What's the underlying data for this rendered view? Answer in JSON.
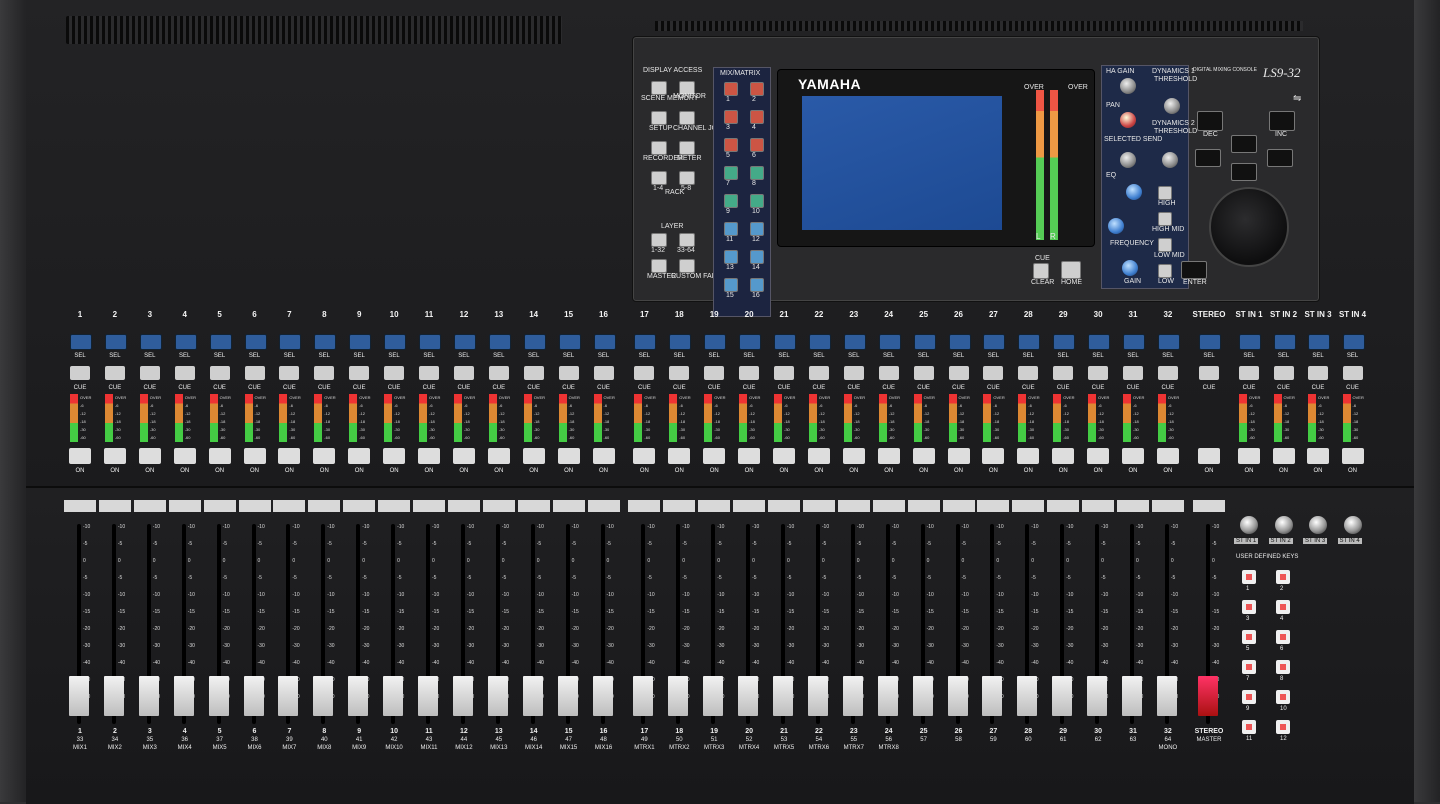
{
  "panel": {
    "display_access": "DISPLAY ACCESS",
    "scene_memory": "SCENE MEMORY",
    "monitor": "MONITOR",
    "setup": "SETUP",
    "channel_job": "CHANNEL JOB",
    "recorder": "RECORDER",
    "meter": "METER",
    "rack_1_4": "1-4",
    "rack": "RACK",
    "rack_5_8": "5-8",
    "layer": "LAYER",
    "layer_1_32": "1-32",
    "layer_33_64": "33-64",
    "master": "MASTER",
    "custom_fader": "CUSTOM FADER",
    "mix_matrix": "MIX/MATRIX",
    "mm_nums": [
      "1",
      "2",
      "3",
      "4",
      "5",
      "6",
      "7",
      "8",
      "9",
      "10",
      "11",
      "12",
      "13",
      "14",
      "15",
      "16"
    ],
    "brand": "YAMAHA",
    "over_l": "OVER",
    "over_r": "OVER",
    "l": "L",
    "r": "R",
    "cue": "CUE",
    "clear": "CLEAR",
    "home": "HOME",
    "ha_gain": "HA GAIN",
    "pan": "PAN",
    "selected_send": "SELECTED SEND",
    "eq": "EQ",
    "frequency": "FREQUENCY",
    "gain": "GAIN",
    "dynamics1": "DYNAMICS 1",
    "threshold1": "THRESHOLD",
    "dynamics2": "DYNAMICS 2",
    "threshold2": "THRESHOLD",
    "high": "HIGH",
    "high_mid": "HIGH MID",
    "low_mid": "LOW MID",
    "low": "LOW",
    "model_text": "DIGITAL MIXING CONSOLE",
    "model": "LS9-32",
    "dec": "DEC",
    "inc": "INC",
    "enter": "ENTER"
  },
  "strip": {
    "sel": "SEL",
    "cue": "CUE",
    "on": "ON",
    "led_labels": [
      "OVER",
      "-6",
      "-12",
      "-18",
      "-30",
      "-60"
    ],
    "stereo": "STEREO",
    "channels": [
      "1",
      "2",
      "3",
      "4",
      "5",
      "6",
      "7",
      "8",
      "9",
      "10",
      "11",
      "12",
      "13",
      "14",
      "15",
      "16",
      "17",
      "18",
      "19",
      "20",
      "21",
      "22",
      "23",
      "24",
      "25",
      "26",
      "27",
      "28",
      "29",
      "30",
      "31",
      "32"
    ],
    "st_in": [
      "ST IN 1",
      "ST IN 2",
      "ST IN 3",
      "ST IN 4"
    ]
  },
  "faders": {
    "scale": [
      "-10",
      "-5",
      "0",
      "-5",
      "-10",
      "-15",
      "-20",
      "-30",
      "-40",
      "-50",
      "-60",
      "-∞"
    ],
    "bottom_nums": [
      "1",
      "2",
      "3",
      "4",
      "5",
      "6",
      "7",
      "8",
      "9",
      "10",
      "11",
      "12",
      "13",
      "14",
      "15",
      "16",
      "17",
      "18",
      "19",
      "20",
      "21",
      "22",
      "23",
      "24",
      "25",
      "26",
      "27",
      "28",
      "29",
      "30",
      "31",
      "32"
    ],
    "second_nums": [
      "33",
      "34",
      "35",
      "36",
      "37",
      "38",
      "39",
      "40",
      "41",
      "42",
      "43",
      "44",
      "45",
      "46",
      "47",
      "48",
      "49",
      "50",
      "51",
      "52",
      "53",
      "54",
      "55",
      "56",
      "57",
      "58",
      "59",
      "60",
      "61",
      "62",
      "63",
      "64"
    ],
    "third_labels": [
      "MIX1",
      "MIX2",
      "MIX3",
      "MIX4",
      "MIX5",
      "MIX6",
      "MIX7",
      "MIX8",
      "MIX9",
      "MIX10",
      "MIX11",
      "MIX12",
      "MIX13",
      "MIX14",
      "MIX15",
      "MIX16",
      "MTRX1",
      "MTRX2",
      "MTRX3",
      "MTRX4",
      "MTRX5",
      "MTRX6",
      "MTRX7",
      "MTRX8",
      "",
      "",
      "",
      "",
      "",
      "",
      "",
      "MONO"
    ],
    "stereo": "STEREO",
    "master": "MASTER"
  },
  "user_defined": {
    "title": "USER DEFINED KEYS",
    "keys": [
      "1",
      "2",
      "3",
      "4",
      "5",
      "6",
      "7",
      "8",
      "9",
      "10",
      "11",
      "12"
    ]
  }
}
